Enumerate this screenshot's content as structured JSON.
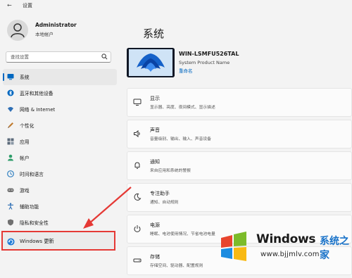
{
  "window": {
    "back_icon": "back-arrow-icon",
    "title": "设置"
  },
  "profile": {
    "name": "Administrator",
    "account_type": "本地帐户"
  },
  "search": {
    "placeholder": "查找设置"
  },
  "nav": [
    {
      "label": "系统",
      "icon": "monitor-icon",
      "color": "#0067c0",
      "active": true
    },
    {
      "label": "蓝牙和其他设备",
      "icon": "bluetooth-icon",
      "color": "#0067c0"
    },
    {
      "label": "网络 & Internet",
      "icon": "wifi-icon",
      "color": "#2f6fb5"
    },
    {
      "label": "个性化",
      "icon": "brush-icon",
      "color": "#c07a2e"
    },
    {
      "label": "应用",
      "icon": "apps-icon",
      "color": "#5b6a7a"
    },
    {
      "label": "帐户",
      "icon": "person-icon",
      "color": "#2e9d6a"
    },
    {
      "label": "时间和语言",
      "icon": "clock-globe-icon",
      "color": "#2f7fc0"
    },
    {
      "label": "游戏",
      "icon": "gamepad-icon",
      "color": "#707070"
    },
    {
      "label": "辅助功能",
      "icon": "accessibility-icon",
      "color": "#2f6fb5"
    },
    {
      "label": "隐私和安全性",
      "icon": "shield-icon",
      "color": "#707070"
    }
  ],
  "update_item": {
    "label": "Windows 更新",
    "icon": "windows-update-icon",
    "highlight_color": "#e53935"
  },
  "main": {
    "title": "系统",
    "device": {
      "name": "WIN-LSMFU526TAL",
      "model": "System Product Name",
      "rename": "重命名"
    },
    "cards": [
      {
        "title": "显示",
        "subtitle": "显示器、亮度、夜间模式、显示描述",
        "icon": "display-icon"
      },
      {
        "title": "声音",
        "subtitle": "音量级别、输出、输入、声音设备",
        "icon": "speaker-icon"
      },
      {
        "title": "通知",
        "subtitle": "来自应用和系统的警报",
        "icon": "bell-icon"
      },
      {
        "title": "专注助手",
        "subtitle": "通知、自动规则",
        "icon": "moon-icon"
      },
      {
        "title": "电源",
        "subtitle": "睡眠、电池使用情况、节省电池电量",
        "icon": "power-icon"
      },
      {
        "title": "存储",
        "subtitle": "存储空间、驱动器、配置规则",
        "icon": "storage-icon"
      }
    ]
  },
  "watermark": {
    "brand": "Windows",
    "suffix": "系统之家",
    "url": "www.bjjmlv.com"
  },
  "colors": {
    "accent": "#0067c0",
    "arrow": "#e53935"
  }
}
